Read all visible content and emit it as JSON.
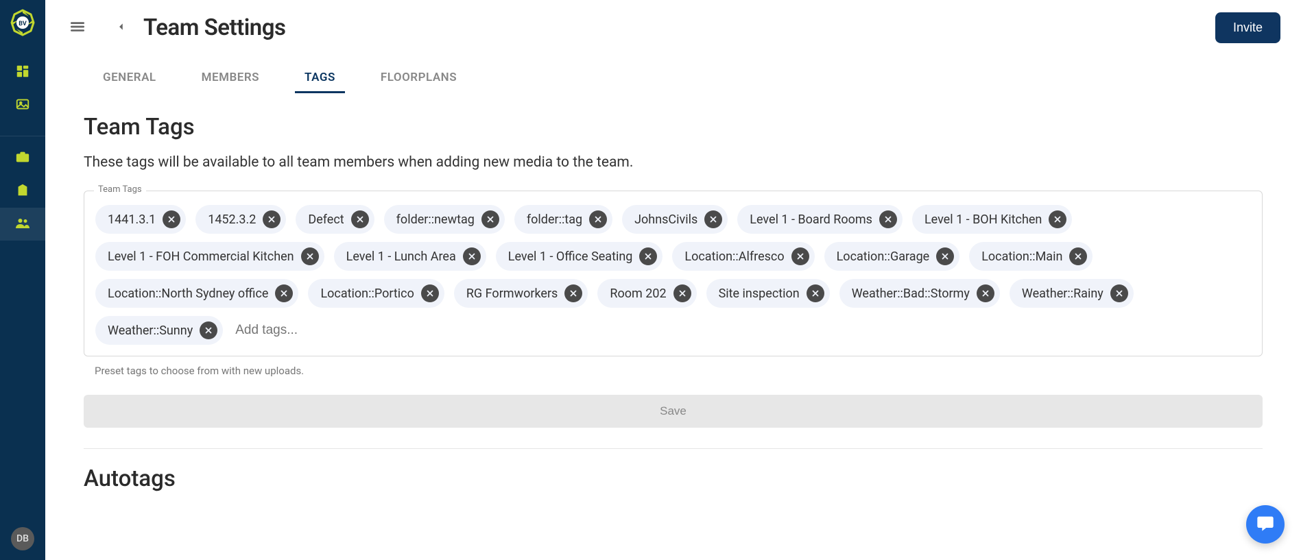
{
  "sidebar": {
    "avatar_initials": "DB"
  },
  "header": {
    "title": "Team Settings",
    "invite_label": "Invite"
  },
  "tabs": [
    {
      "label": "GENERAL",
      "active": false
    },
    {
      "label": "MEMBERS",
      "active": false
    },
    {
      "label": "TAGS",
      "active": true
    },
    {
      "label": "FLOORPLANS",
      "active": false
    }
  ],
  "team_tags": {
    "title": "Team Tags",
    "description": "These tags will be available to all team members when adding new media to the team.",
    "legend": "Team Tags",
    "tags": [
      "1441.3.1",
      "1452.3.2",
      "Defect",
      "folder::newtag",
      "folder::tag",
      "JohnsCivils",
      "Level 1 - Board Rooms",
      "Level 1 - BOH Kitchen",
      "Level 1 - FOH Commercial Kitchen",
      "Level 1 - Lunch Area",
      "Level 1 - Office Seating",
      "Location::Alfresco",
      "Location::Garage",
      "Location::Main",
      "Location::North Sydney office",
      "Location::Portico",
      "RG Formworkers",
      "Room 202",
      "Site inspection",
      "Weather::Bad::Stormy",
      "Weather::Rainy",
      "Weather::Sunny"
    ],
    "add_placeholder": "Add tags...",
    "helper": "Preset tags to choose from with new uploads.",
    "save_label": "Save"
  },
  "autotags": {
    "title": "Autotags"
  }
}
